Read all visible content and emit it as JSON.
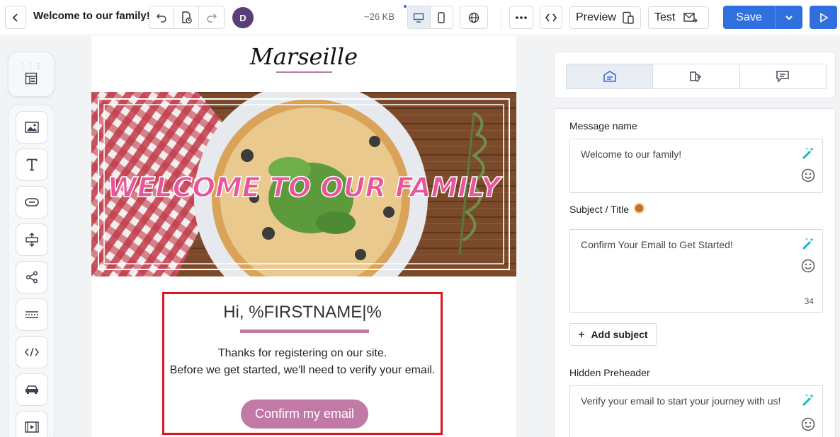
{
  "header": {
    "title": "Welcome to our family!",
    "avatar_initial": "D",
    "size": "~26 KB",
    "preview_label": "Preview",
    "test_label": "Test",
    "save_label": "Save"
  },
  "rail": {
    "tools": [
      "image-icon",
      "text-icon",
      "button-icon",
      "spacer-icon",
      "share-icon",
      "divider-icon",
      "html-icon",
      "menu-icon",
      "video-icon"
    ]
  },
  "email": {
    "logo": "Marseille",
    "hero_text": "WELCOME TO OUR FAMILY",
    "greeting": "Hi, %FIRSTNAME|%",
    "line1": "Thanks for registering on our site.",
    "line2": "Before we get started, we'll need to verify your email.",
    "cta": "Confirm my email"
  },
  "panel": {
    "message_name_label": "Message name",
    "message_name_value": "Welcome to our family!",
    "subject_label": "Subject / Title",
    "subject_value": "Confirm Your Email to Get Started!",
    "subject_count": "34",
    "add_subject_label": "Add subject",
    "preheader_label": "Hidden Preheader",
    "preheader_value": "Verify your email to start your journey with us!"
  },
  "colors": {
    "accent": "#2f6fde",
    "brand": "#c07aa5",
    "highlight": "#e0161b"
  }
}
